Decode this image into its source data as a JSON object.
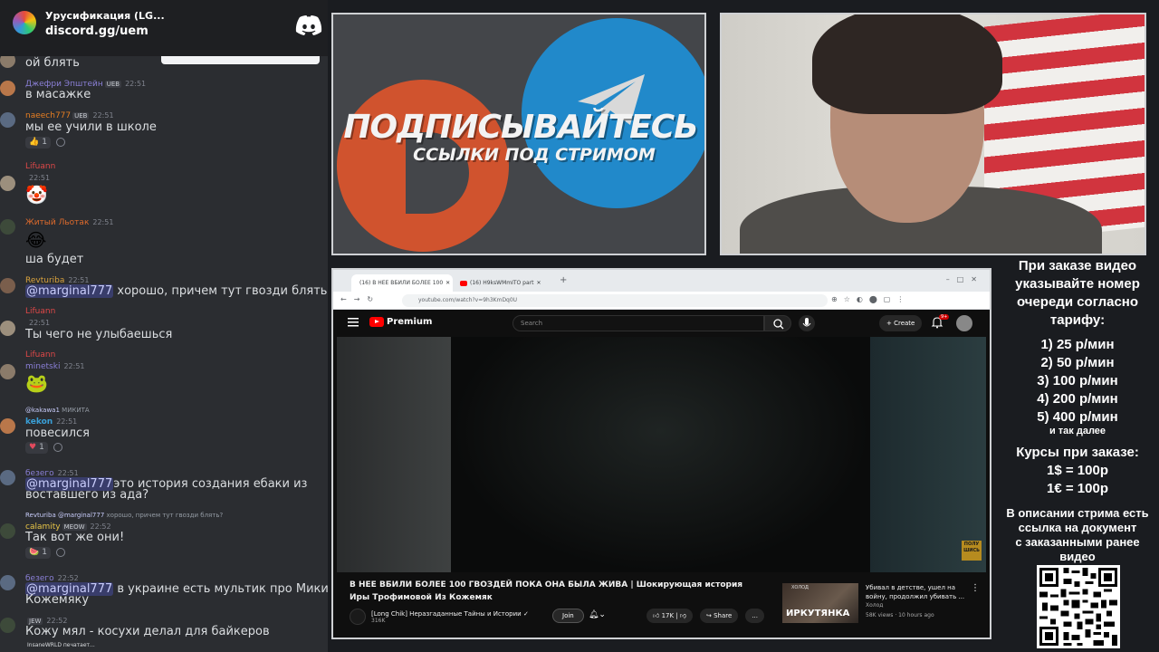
{
  "discord": {
    "server_name": "Урусификация (LG...",
    "invite": "discord.gg/uem",
    "typing_indicator": "InsaneWRLD печатает..."
  },
  "chat": [
    {
      "kind": "text",
      "text": "ой блять"
    },
    {
      "user": "Джефри Эпштейн",
      "badge": "UEB",
      "time": "22:51",
      "text": "в масажке"
    },
    {
      "user": "naeech777",
      "badge": "UEB",
      "time": "22:51",
      "text": "мы ее учили в школе",
      "reaction": "1"
    },
    {
      "user": "Lifuann",
      "time": "22:51",
      "emoji": "🤡"
    },
    {
      "user": "Житый Льотак",
      "time": "22:51",
      "emoji": "😂",
      "text": "ша будет"
    },
    {
      "user": "Revturiba",
      "time": "22:51",
      "mention": "@marginal777",
      "text": "хорошо, причем тут гвозди блять?"
    },
    {
      "user": "Lifuann",
      "time": "22:51",
      "text": "Ты чего не улыбаешься"
    },
    {
      "user": "Lifuann",
      "extra_user": "minetski",
      "time": "22:51",
      "emoji": "🐸"
    },
    {
      "reply_user": "@kakawa1",
      "reply_text": "МИКИТА",
      "user": "kekon",
      "time": "22:51",
      "text": "повесился",
      "reaction": "1"
    },
    {
      "user": "безего",
      "time": "22:51",
      "mention": "@marginal777",
      "text": "это история создания ебаки из",
      "text2": "воставшего из ада?"
    },
    {
      "reply_user": "Revturiba",
      "reply_mention": "@marginal777",
      "reply_text": "хорошо, причем тут гвозди блять?",
      "user": "calamity",
      "badge": "MEOW",
      "time": "22:52",
      "text": "Так вот же они!",
      "reaction": "1"
    },
    {
      "user": "безего",
      "time": "22:52",
      "mention": "@marginal777",
      "text": "в украине есть мультик про Микиту",
      "text2": "Кожемяку"
    },
    {
      "user": "",
      "badge": "JEW",
      "time": "22:52",
      "text": "Кожу мял - косухи делал для байкеров"
    }
  ],
  "banner": {
    "title": "ПОДПИСЫВАЙТЕСЬ",
    "subtitle": "ССЫЛКИ ПОД СТРИМОМ"
  },
  "browser": {
    "tab1": "(16) В НЕЕ ВБИЛИ БОЛЕЕ 100",
    "tab2": "(16) H9ksWMmITO part",
    "url": "youtube.com/watch?v=9h3KmDq0U",
    "yt_logo": "Premium",
    "search_placeholder": "Search",
    "create_label": "Create",
    "bell_badge": "9+",
    "video_title": "В НЕЕ ВБИЛИ БОЛЕЕ 100 ГВОЗДЕЙ ПОКА ОНА БЫЛА ЖИВА | Шокирующая история Иры Трофимовой Из Кожемяк",
    "channel_name": "[Long Chik] Неразгаданные Тайны и Истории",
    "channel_subs": "316K",
    "join_label": "Join",
    "likes": "17K",
    "share_label": "Share",
    "more_label": "...",
    "watermark": "ПОЛУ ШИСЬ",
    "rec": {
      "thumb_text": "ИРКУТЯНКА",
      "thumb_top": "ХОЛОД",
      "title": "Убивал в детстве, ушел на войну, продолжил убивать ...",
      "channel": "Холод",
      "meta": "58K views · 10 hours ago"
    }
  },
  "info": {
    "header": [
      "При заказе видео",
      "указывайте номер",
      "очереди согласно",
      "тарифу:"
    ],
    "tiers": [
      "1) 25 р/мин",
      "2) 50 р/мин",
      "3) 100 р/мин",
      "4) 200 р/мин",
      "5) 400 р/мин"
    ],
    "and_so_on": "и так далее",
    "courses_title": "Курсы при заказе:",
    "courses": [
      "1$ = 100р",
      "1€ = 100р"
    ],
    "description": [
      "В описании стрима есть",
      "ссылка на документ",
      "с заказанными ранее",
      "видео"
    ]
  },
  "colors": {
    "discord_bg": "#2b2d31",
    "mention": "#c9cdfb",
    "yt_red": "#ff0000",
    "telegram_blue": "#2189ca",
    "red_logo": "#d0532e"
  }
}
